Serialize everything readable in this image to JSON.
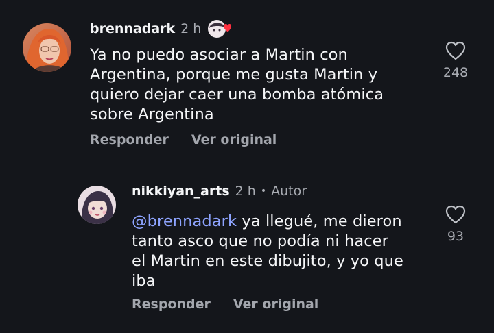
{
  "comments": [
    {
      "username": "brennadark",
      "time": "2 h",
      "lines": [
        "Ya no puedo asociar a Martin con",
        "Argentina, porque me gusta Martin y",
        "quiero dejar caer una bomba atómica",
        "sobre Argentina"
      ],
      "reply_label": "Responder",
      "translate_label": "Ver original",
      "likes": "248",
      "reaction_icon": "creator-liked-heart-avatar-icon",
      "colors": {
        "heart_badge": "#ff3040"
      }
    },
    {
      "username": "nikkiyan_arts",
      "time": "2 h",
      "separator": "•",
      "author_label": "Autor",
      "mention": "@brennadark",
      "lines": [
        " ya llegué, me dieron",
        "tanto asco que no podía ni hacer",
        "el Martin en este dibujito, y yo que",
        "iba"
      ],
      "reply_label": "Responder",
      "translate_label": "Ver original",
      "likes": "93"
    }
  ],
  "colors": {
    "background": "#14161b",
    "text": "#f5f6f8",
    "muted": "#a8abb2",
    "mention": "#8ea4ff"
  }
}
